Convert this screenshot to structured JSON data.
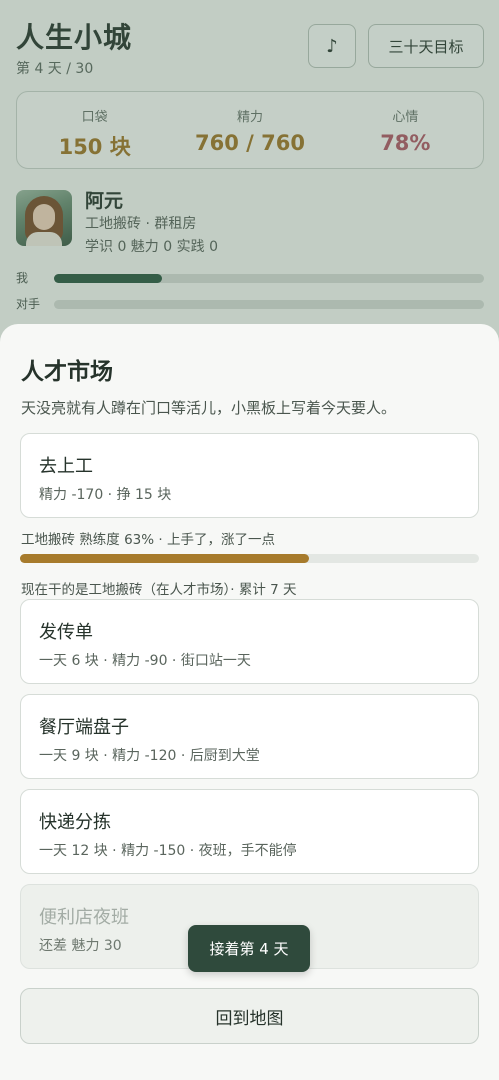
{
  "header": {
    "title": "人生小城",
    "day": "第 4 天 / 30",
    "music_label": "♪",
    "goal_label": "三十天目标"
  },
  "stats": {
    "money_label": "口袋",
    "money_value": "150 块",
    "energy_label": "精力",
    "energy_value": "760 / 760",
    "mood_label": "心情",
    "mood_value": "78%",
    "colors": {
      "money": "#a0782c",
      "energy": "#a0782c",
      "mood": "#b05a68"
    }
  },
  "profile": {
    "name": "阿元",
    "job": "工地搬砖 · 群租房",
    "skills": "学识 0 魅力 0 实践 0"
  },
  "race": {
    "me_label": "我",
    "me_progress": 0.25,
    "rival_label": "对手",
    "rival_progress": 0
  },
  "sheet": {
    "title": "人才市场",
    "description": "天没亮就有人蹲在门口等活儿，小黑板上写着今天要人。",
    "work": {
      "title": "去上工",
      "sub": "精力 -170 · 挣 15 块"
    },
    "skill": {
      "text": "工地搬砖 熟练度 63% · 上手了，涨了一点",
      "progress": 0.63
    },
    "current": "现在干的是工地搬砖（在人才市场）· 累计 7 天",
    "jobs": [
      {
        "title": "发传单",
        "sub": "一天 6 块 · 精力 -90 · 街口站一天",
        "enabled": true
      },
      {
        "title": "餐厅端盘子",
        "sub": "一天 9 块 · 精力 -120 · 后厨到大堂",
        "enabled": true
      },
      {
        "title": "快递分拣",
        "sub": "一天 12 块 · 精力 -150 · 夜班，手不能停",
        "enabled": true
      },
      {
        "title": "便利店夜班",
        "sub": "还差 魅力 30",
        "enabled": false
      }
    ],
    "back_label": "回到地图"
  },
  "toast": {
    "text": "接着第 4 天"
  },
  "colors": {
    "accent": "#2f5a45",
    "skill_bar": "#a77b2c",
    "toast_bg": "#2f4a3c"
  }
}
